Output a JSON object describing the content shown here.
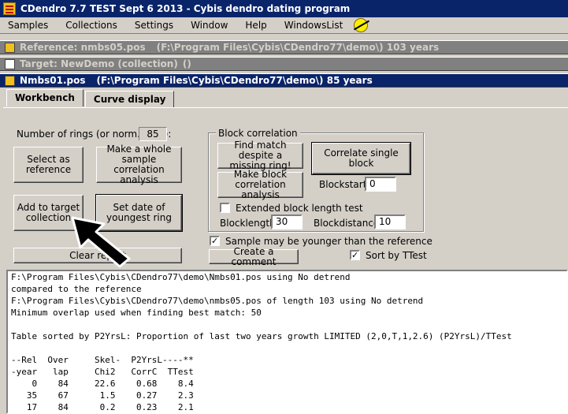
{
  "window": {
    "title": "CDendro 7.7 TEST Sept 6 2013 - Cybis dendro dating program"
  },
  "menu": {
    "items": [
      {
        "label": "Samples"
      },
      {
        "label": "Collections"
      },
      {
        "label": "Settings"
      },
      {
        "label": "Window"
      },
      {
        "label": "Help"
      },
      {
        "label": "WindowsList"
      }
    ]
  },
  "subwindows": {
    "reference": {
      "name": "Reference: nmbs05.pos",
      "path": "(F:\\Program Files\\Cybis\\CDendro77\\demo\\)  103 years"
    },
    "target": {
      "name": "Target: NewDemo (collection)",
      "path": "()"
    },
    "sample": {
      "name": "Nmbs01.pos",
      "path": "(F:\\Program Files\\Cybis\\CDendro77\\demo\\)  85 years"
    }
  },
  "tabs": [
    {
      "label": "Workbench"
    },
    {
      "label": "Curve display"
    }
  ],
  "workbench": {
    "rings_label": "Number of rings (or norm. data):",
    "rings_value": "85",
    "select_reference": "Select as reference",
    "whole_correlation": "Make a whole sample correlation analysis",
    "add_target": "Add to target collection",
    "set_date": "Set date of youngest ring",
    "clear_report": "Clear report",
    "block": {
      "title": "Block correlation",
      "find_match": "Find match despite a missing ring!",
      "make_block": "Make block correlation analysis",
      "correlate_single": "Correlate single block",
      "blockstart_label": "Blockstart:",
      "blockstart_value": "0",
      "extended_label": "Extended block length test",
      "blocklength_label": "Blocklength:",
      "blocklength_value": "30",
      "blockdistance_label": "Blockdistance:",
      "blockdistance_value": "10"
    },
    "younger_label": "Sample may be younger than the reference",
    "create_comment": "Create a comment",
    "sort_label": "Sort by TTest"
  },
  "output": {
    "lines": [
      "F:\\Program Files\\Cybis\\CDendro77\\demo\\Nmbs01.pos using No detrend",
      "compared to the reference",
      "F:\\Program Files\\Cybis\\CDendro77\\demo\\nmbs05.pos of length 103 using No detrend",
      "Minimum overlap used when finding best match: 50",
      "",
      "Table sorted by P2YrsL: Proportion of last two years growth LIMITED (2,0,T,1,2.6) (P2YrsL)/TTest",
      "",
      "--Rel  Over     Skel-  P2YrsL----**",
      "-year   lap     Chi2   CorrC  TTest",
      "    0    84     22.6    0.68    8.4",
      "   35    67      1.5    0.27    2.3",
      "   17    84      0.2    0.23    2.1"
    ]
  }
}
